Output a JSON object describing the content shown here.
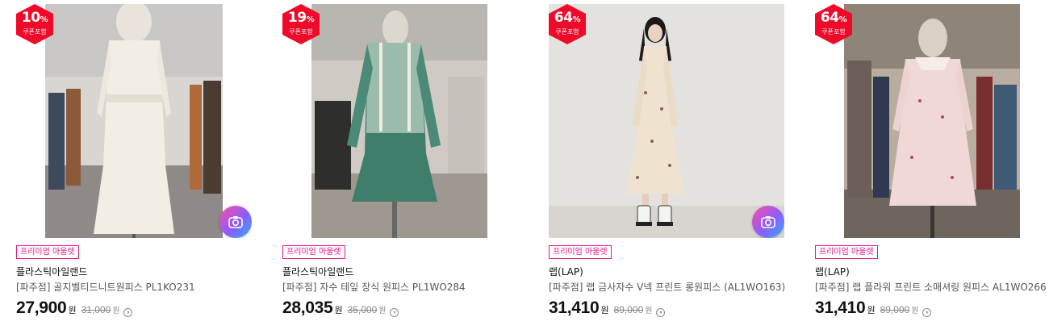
{
  "products": [
    {
      "discount": "10",
      "discount_unit": "%",
      "discount_label": "쿠폰포함",
      "tag": "프리미엄 아울렛",
      "brand": "플라스틱아일랜드",
      "name": "[파주점] 골지벨티드니트원피스 PL1KO231",
      "price": "27,900",
      "price_unit": "원",
      "original_price": "31,000",
      "original_unit": "원",
      "has_camera_icon": true
    },
    {
      "discount": "19",
      "discount_unit": "%",
      "discount_label": "쿠폰포함",
      "tag": "프리미엄 아울렛",
      "brand": "플라스틱아일랜드",
      "name": "[파주점] 자수 테잎 장식 원피스 PL1WO284",
      "price": "28,035",
      "price_unit": "원",
      "original_price": "35,000",
      "original_unit": "원",
      "has_camera_icon": false
    },
    {
      "discount": "64",
      "discount_unit": "%",
      "discount_label": "쿠폰포함",
      "tag": "프리미엄 아울렛",
      "brand": "랩(LAP)",
      "name": "[파주점] 랩 금사자수 V넥 프린트 롱원피스 (AL1WO163)",
      "price": "31,410",
      "price_unit": "원",
      "original_price": "89,000",
      "original_unit": "원",
      "has_camera_icon": true
    },
    {
      "discount": "64",
      "discount_unit": "%",
      "discount_label": "쿠폰포함",
      "tag": "프리미엄 아울렛",
      "brand": "랩(LAP)",
      "name": "[파주점] 랩 플라워 프린트 소매셔링 원피스 AL1WO266",
      "price": "31,410",
      "price_unit": "원",
      "original_price": "89,000",
      "original_unit": "원",
      "has_camera_icon": false
    }
  ],
  "icons": {
    "camera": "camera-icon",
    "info": "info-circle-icon",
    "discount_badge": "hexagon-badge"
  },
  "colors": {
    "badge": "#ef0a2a",
    "tag": "#e8158f",
    "price": "#111111",
    "original_price": "#888888"
  }
}
